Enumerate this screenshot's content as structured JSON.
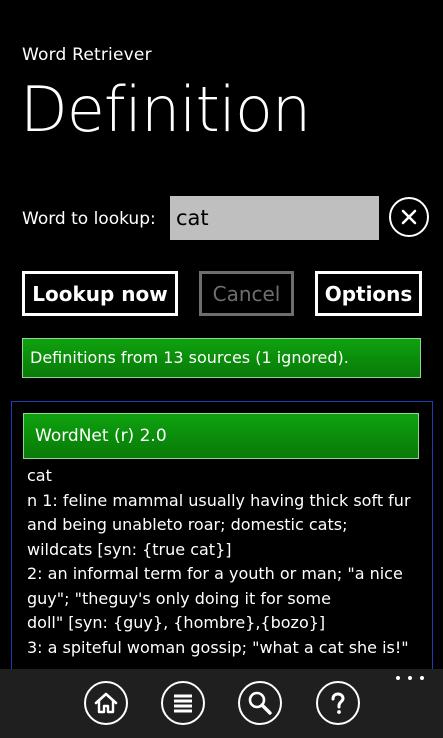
{
  "header": {
    "app_title": "Word Retriever",
    "page_title": "Definition"
  },
  "lookup": {
    "label": "Word to lookup:",
    "value": "cat"
  },
  "buttons": {
    "lookup_now": "Lookup now",
    "cancel": "Cancel",
    "options": "Options"
  },
  "status": {
    "text": "Definitions from 13 sources (1 ignored)."
  },
  "results": {
    "source_name": "WordNet (r) 2.0",
    "definition": "cat\nn 1: feline mammal usually having thick soft fur\nand being unableto roar; domestic cats;\nwildcats [syn: {true cat}]\n2: an informal term for a youth or man; \"a nice\nguy\"; \"theguy's only doing it for some\ndoll\" [syn: {guy}, {hombre},{bozo}]\n3: a spiteful woman gossip; \"what a cat she is!\""
  },
  "app_bar": {
    "icons": [
      "home-icon",
      "list-icon",
      "search-icon",
      "help-icon"
    ],
    "more": "more-icon"
  },
  "colors": {
    "background": "#000000",
    "accent_green": "#0a9a0a",
    "input_bg": "#bfbfbf",
    "panel_border": "#1e3cb4",
    "app_bar_bg": "#1f1f1f"
  }
}
